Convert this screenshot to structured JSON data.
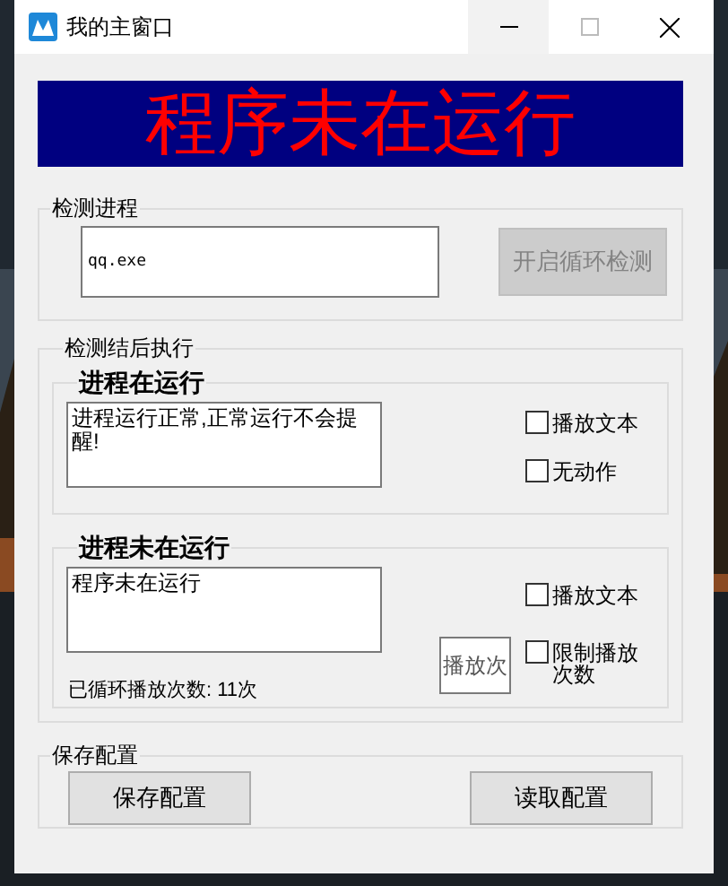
{
  "window": {
    "title": "我的主窗口"
  },
  "banner": {
    "text": "程序未在运行"
  },
  "detect_group": {
    "title": "检测进程",
    "process_field": {
      "value": "qq.exe"
    },
    "start_button": {
      "label": "开启循环检测",
      "disabled": true
    }
  },
  "action_group": {
    "title": "检测结后执行",
    "running": {
      "title": "进程在运行",
      "message": "进程运行正常,正常运行不会提醒!",
      "options": [
        {
          "label": "播放文本",
          "checked": false
        },
        {
          "label": "无动作",
          "checked": false
        }
      ]
    },
    "not_running": {
      "title": "进程未在运行",
      "message": "程序未在运行",
      "options": [
        {
          "label": "播放文本",
          "checked": false
        },
        {
          "label": "限制播放次数",
          "checked": false
        }
      ],
      "count_button": {
        "label": "播放次"
      },
      "count_label": "已循环播放次数: 11次"
    }
  },
  "save_group": {
    "title": "保存配置",
    "buttons": [
      {
        "label": "保存配置"
      },
      {
        "label": "读取配置"
      }
    ]
  }
}
